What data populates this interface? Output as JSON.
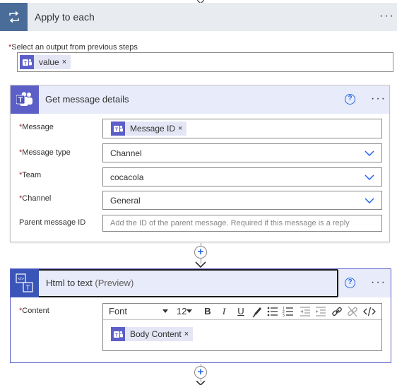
{
  "apply_to_each": {
    "title": "Apply to each",
    "more_label": "···",
    "select_label": "Select an output from previous steps",
    "required_mark": "*",
    "value_chip": "value",
    "chip_remove": "×"
  },
  "get_message_details": {
    "title": "Get message details",
    "help_label": "?",
    "more_label": "···",
    "fields": {
      "message": {
        "label": "Message",
        "chip": "Message ID"
      },
      "message_type": {
        "label": "Message type",
        "value": "Channel"
      },
      "team": {
        "label": "Team",
        "value": "cocacola"
      },
      "channel": {
        "label": "Channel",
        "value": "General"
      },
      "parent_message_id": {
        "label": "Parent message ID",
        "placeholder": "Add the ID of the parent message. Required if this message is a reply"
      }
    }
  },
  "html_to_text": {
    "title": "Html to text",
    "preview": "(Preview)",
    "help_label": "?",
    "more_label": "···",
    "content_label": "Content",
    "toolbar": {
      "font": "Font",
      "size": "12",
      "bold": "B",
      "italic": "I",
      "underline": "U"
    },
    "content_chip": "Body Content"
  },
  "connector": {
    "add_label": "+"
  },
  "colors": {
    "teams_purple": "#5b5fc7",
    "header_tint": "#e8ebfa",
    "loop_blue": "#4a6c98",
    "link_blue": "#2266e3",
    "required_red": "#a4262c"
  },
  "icons": [
    "loop-icon",
    "teams-icon",
    "html-to-text-icon",
    "help-icon",
    "chevron-down-icon",
    "add-step-icon"
  ]
}
